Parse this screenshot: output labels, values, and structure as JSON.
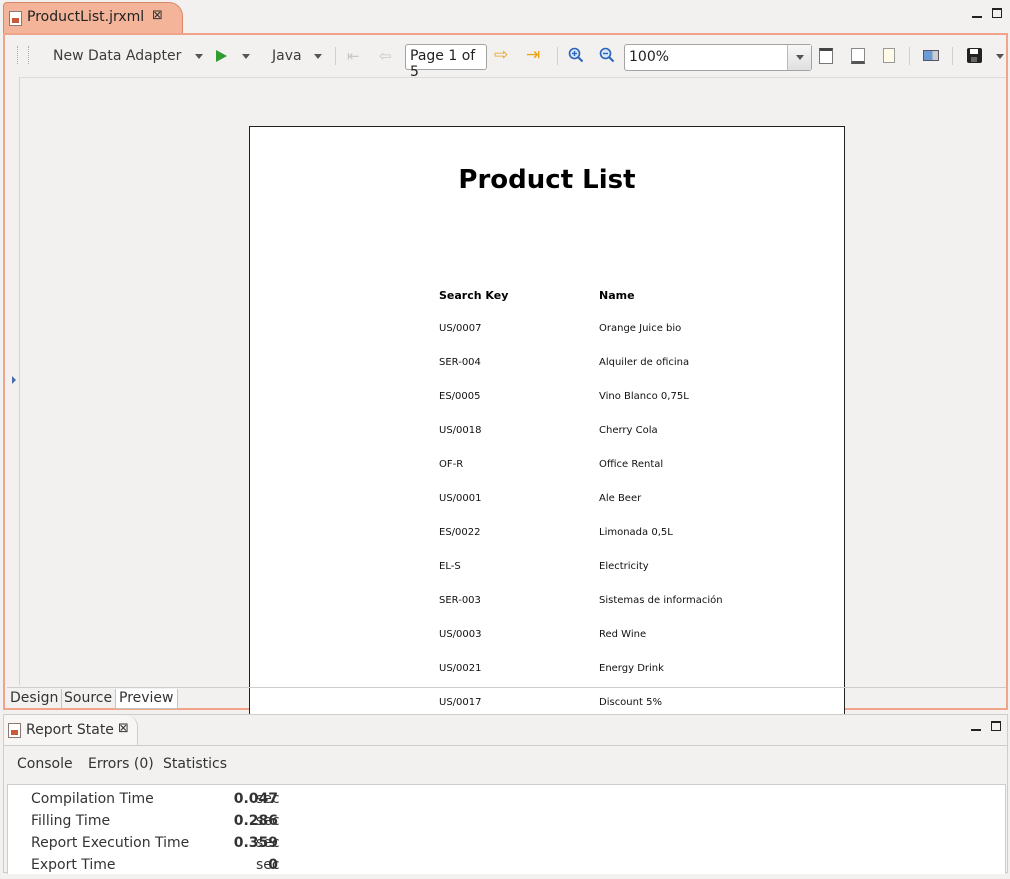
{
  "editor": {
    "tab_label": "ProductList.jrxml",
    "toolbar": {
      "data_adapter": "New Data Adapter",
      "language": "Java",
      "page_indicator": "Page 1 of 5",
      "zoom_value": "100%"
    },
    "report": {
      "title": "Product List",
      "columns": [
        "Search Key",
        "Name"
      ],
      "rows": [
        [
          "US/0007",
          "Orange Juice bio"
        ],
        [
          "SER-004",
          "Alquiler de oficina"
        ],
        [
          "ES/0005",
          "Vino Blanco 0,75L"
        ],
        [
          "US/0018",
          "Cherry Cola"
        ],
        [
          "OF-R",
          "Office Rental"
        ],
        [
          "US/0001",
          "Ale Beer"
        ],
        [
          "ES/0022",
          "Limonada 0,5L"
        ],
        [
          "EL-S",
          "Electricity"
        ],
        [
          "SER-003",
          "Sistemas de información"
        ],
        [
          "US/0003",
          "Red Wine"
        ],
        [
          "US/0021",
          "Energy Drink"
        ],
        [
          "US/0017",
          "Discount 5%"
        ]
      ]
    },
    "bottom_tabs": [
      "Design",
      "Source",
      "Preview"
    ],
    "active_bottom_tab": "Preview"
  },
  "report_state": {
    "tab_label": "Report State",
    "nav": [
      "Console",
      "Errors (0)",
      "Statistics"
    ],
    "stats": [
      {
        "label": "Compilation Time",
        "value": "0.047",
        "unit": "sec"
      },
      {
        "label": "Filling Time",
        "value": "0.286",
        "unit": "sec"
      },
      {
        "label": "Report Execution Time",
        "value": "0.359",
        "unit": "sec"
      },
      {
        "label": "Export Time",
        "value": "0",
        "unit": "sec"
      }
    ]
  },
  "colors": {
    "active_tab": "#f3b49a",
    "active_border": "#f0a58a",
    "run_green": "#2e9d2e",
    "nav_arrow_orange": "#e8a317",
    "zoom_blue": "#2b64b8"
  }
}
